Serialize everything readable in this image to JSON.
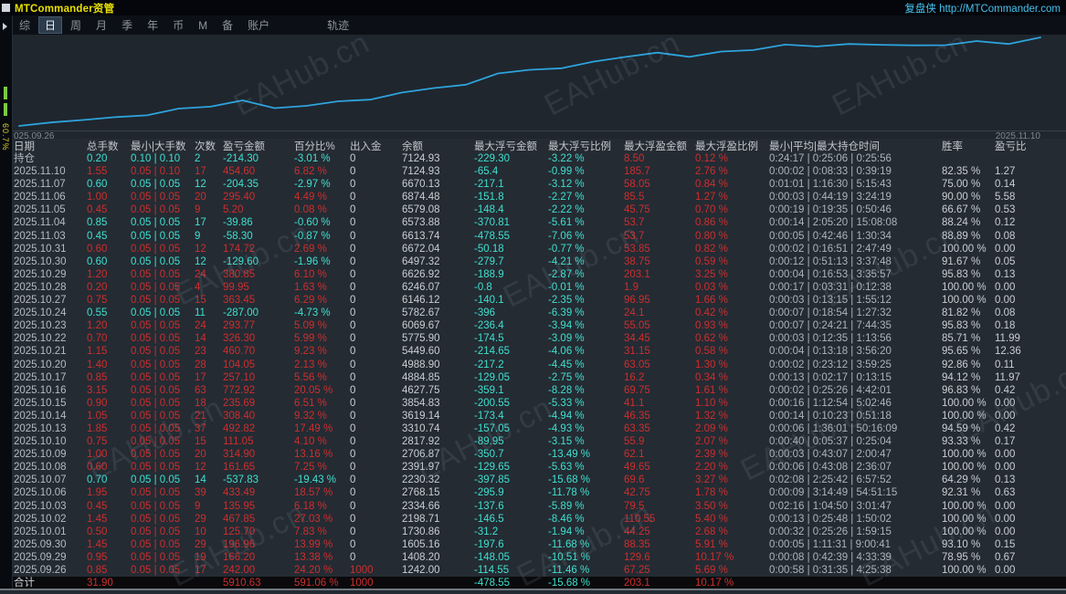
{
  "window": {
    "title": "MTCommander资管",
    "brand": "复盘侠 http://MTCommander.com"
  },
  "menu": {
    "items": [
      "综",
      "日",
      "周",
      "月",
      "季",
      "年",
      "币",
      "M",
      "备",
      "账户",
      "轨迹"
    ],
    "active": "日"
  },
  "left_strip": {
    "label": "60.7%"
  },
  "watermark": "EAHub.cn",
  "chart_data": {
    "type": "line",
    "name": "余额",
    "x_start_label": "025.09.26",
    "x_end_label": "2025.11.10",
    "initial_value": 1000,
    "dates": [
      "2025.09.26",
      "2025.09.29",
      "2025.09.30",
      "2025.10.01",
      "2025.10.02",
      "2025.10.03",
      "2025.10.06",
      "2025.10.07",
      "2025.10.08",
      "2025.10.09",
      "2025.10.10",
      "2025.10.13",
      "2025.10.14",
      "2025.10.15",
      "2025.10.16",
      "2025.10.17",
      "2025.10.20",
      "2025.10.21",
      "2025.10.22",
      "2025.10.23",
      "2025.10.24",
      "2025.10.27",
      "2025.10.28",
      "2025.10.29",
      "2025.10.30",
      "2025.10.31",
      "2025.11.03",
      "2025.11.04",
      "2025.11.05",
      "2025.11.06",
      "2025.11.07",
      "2025.11.10"
    ],
    "values": [
      1000,
      1242.0,
      1408.2,
      1605.16,
      1730.86,
      2198.71,
      2334.66,
      2768.15,
      2230.32,
      2391.97,
      2706.87,
      2817.92,
      3310.74,
      3619.14,
      3854.83,
      4627.75,
      4884.85,
      4988.9,
      5449.6,
      5775.9,
      6069.67,
      5782.67,
      6146.12,
      6246.07,
      6626.92,
      6497.32,
      6672.04,
      6613.74,
      6573.88,
      6579.08,
      6874.48,
      6670.13,
      7124.93
    ],
    "ylim": [
      1000,
      7200
    ],
    "line_color": "#2ea3dc",
    "grid": false,
    "legend": false
  },
  "table": {
    "columns": [
      {
        "key": "date",
        "label": "日期"
      },
      {
        "key": "lots",
        "label": "总手数"
      },
      {
        "key": "minmax",
        "label": "最小|大手数"
      },
      {
        "key": "count",
        "label": "次数"
      },
      {
        "key": "pnl",
        "label": "盈亏金额"
      },
      {
        "key": "pct",
        "label": "百分比%"
      },
      {
        "key": "inout",
        "label": "出入金"
      },
      {
        "key": "balance",
        "label": "余额"
      },
      {
        "key": "maxdd",
        "label": "最大浮亏金额"
      },
      {
        "key": "maxdd_pct",
        "label": "最大浮亏比例"
      },
      {
        "key": "maxfp",
        "label": "最大浮盈金额"
      },
      {
        "key": "maxfp_pct",
        "label": "最大浮盈比例"
      },
      {
        "key": "times",
        "label": "最小|平均|最大持仓时间"
      },
      {
        "key": "winrate",
        "label": "胜率"
      },
      {
        "key": "ratio",
        "label": "盈亏比"
      }
    ],
    "rows": [
      {
        "date": "持仓",
        "lots": "0.20",
        "minmax": "0.10 | 0.10",
        "count": "2",
        "pnl": "-214.30",
        "pct": "-3.01 %",
        "inout": "0",
        "balance": "7124.93",
        "maxdd": "-229.30",
        "maxdd_pct": "-3.22 %",
        "maxfp": "8.50",
        "maxfp_pct": "0.12 %",
        "times": "0:24:17 | 0:25:06 | 0:25:56",
        "winrate": "",
        "ratio": ""
      },
      {
        "date": "2025.11.10",
        "lots": "1.55",
        "minmax": "0.05 | 0.10",
        "count": "17",
        "pnl": "454.60",
        "pct": "6.82 %",
        "inout": "0",
        "balance": "7124.93",
        "maxdd": "-65.4",
        "maxdd_pct": "-0.99 %",
        "maxfp": "185.7",
        "maxfp_pct": "2.76 %",
        "times": "0:00:02 | 0:08:33 | 0:39:19",
        "winrate": "82.35 %",
        "ratio": "1.27"
      },
      {
        "date": "2025.11.07",
        "lots": "0.60",
        "minmax": "0.05 | 0.05",
        "count": "12",
        "pnl": "-204.35",
        "pct": "-2.97 %",
        "inout": "0",
        "balance": "6670.13",
        "maxdd": "-217.1",
        "maxdd_pct": "-3.12 %",
        "maxfp": "58.05",
        "maxfp_pct": "0.84 %",
        "times": "0:01:01 | 1:16:30 | 5:15:43",
        "winrate": "75.00 %",
        "ratio": "0.14"
      },
      {
        "date": "2025.11.06",
        "lots": "1.00",
        "minmax": "0.05 | 0.05",
        "count": "20",
        "pnl": "295.40",
        "pct": "4.49 %",
        "inout": "0",
        "balance": "6874.48",
        "maxdd": "-151.8",
        "maxdd_pct": "-2.27 %",
        "maxfp": "85.5",
        "maxfp_pct": "1.27 %",
        "times": "0:00:03 | 0:44:19 | 3:24:19",
        "winrate": "90.00 %",
        "ratio": "5.58"
      },
      {
        "date": "2025.11.05",
        "lots": "0.45",
        "minmax": "0.05 | 0.05",
        "count": "9",
        "pnl": "5.20",
        "pct": "0.08 %",
        "inout": "0",
        "balance": "6579.08",
        "maxdd": "-148.4",
        "maxdd_pct": "-2.22 %",
        "maxfp": "45.75",
        "maxfp_pct": "0.70 %",
        "times": "0:00:19 | 0:19:35 | 0:50:46",
        "winrate": "66.67 %",
        "ratio": "0.53"
      },
      {
        "date": "2025.11.04",
        "lots": "0.85",
        "minmax": "0.05 | 0.05",
        "count": "17",
        "pnl": "-39.86",
        "pct": "-0.60 %",
        "inout": "0",
        "balance": "6573.88",
        "maxdd": "-370.81",
        "maxdd_pct": "-5.61 %",
        "maxfp": "53.7",
        "maxfp_pct": "0.86 %",
        "times": "0:00:14 | 2:05:20 | 15:08:08",
        "winrate": "88.24 %",
        "ratio": "0.12"
      },
      {
        "date": "2025.11.03",
        "lots": "0.45",
        "minmax": "0.05 | 0.05",
        "count": "9",
        "pnl": "-58.30",
        "pct": "-0.87 %",
        "inout": "0",
        "balance": "6613.74",
        "maxdd": "-478.55",
        "maxdd_pct": "-7.06 %",
        "maxfp": "53.7",
        "maxfp_pct": "0.80 %",
        "times": "0:00:05 | 0:42:46 | 1:30:34",
        "winrate": "88.89 %",
        "ratio": "0.08"
      },
      {
        "date": "2025.10.31",
        "lots": "0.60",
        "minmax": "0.05 | 0.05",
        "count": "12",
        "pnl": "174.72",
        "pct": "2.69 %",
        "inout": "0",
        "balance": "6672.04",
        "maxdd": "-50.18",
        "maxdd_pct": "-0.77 %",
        "maxfp": "53.85",
        "maxfp_pct": "0.82 %",
        "times": "0:00:02 | 0:16:51 | 2:47:49",
        "winrate": "100.00 %",
        "ratio": "0.00"
      },
      {
        "date": "2025.10.30",
        "lots": "0.60",
        "minmax": "0.05 | 0.05",
        "count": "12",
        "pnl": "-129.60",
        "pct": "-1.96 %",
        "inout": "0",
        "balance": "6497.32",
        "maxdd": "-279.7",
        "maxdd_pct": "-4.21 %",
        "maxfp": "38.75",
        "maxfp_pct": "0.59 %",
        "times": "0:00:12 | 0:51:13 | 3:37:48",
        "winrate": "91.67 %",
        "ratio": "0.05"
      },
      {
        "date": "2025.10.29",
        "lots": "1.20",
        "minmax": "0.05 | 0.05",
        "count": "24",
        "pnl": "380.85",
        "pct": "6.10 %",
        "inout": "0",
        "balance": "6626.92",
        "maxdd": "-188.9",
        "maxdd_pct": "-2.87 %",
        "maxfp": "203.1",
        "maxfp_pct": "3.25 %",
        "times": "0:00:04 | 0:16:53 | 3:35:57",
        "winrate": "95.83 %",
        "ratio": "0.13"
      },
      {
        "date": "2025.10.28",
        "lots": "0.20",
        "minmax": "0.05 | 0.05",
        "count": "4",
        "pnl": "99.95",
        "pct": "1.63 %",
        "inout": "0",
        "balance": "6246.07",
        "maxdd": "-0.8",
        "maxdd_pct": "-0.01 %",
        "maxfp": "1.9",
        "maxfp_pct": "0.03 %",
        "times": "0:00:17 | 0:03:31 | 0:12:38",
        "winrate": "100.00 %",
        "ratio": "0.00"
      },
      {
        "date": "2025.10.27",
        "lots": "0.75",
        "minmax": "0.05 | 0.05",
        "count": "15",
        "pnl": "363.45",
        "pct": "6.29 %",
        "inout": "0",
        "balance": "6146.12",
        "maxdd": "-140.1",
        "maxdd_pct": "-2.35 %",
        "maxfp": "96.95",
        "maxfp_pct": "1.66 %",
        "times": "0:00:03 | 0:13:15 | 1:55:12",
        "winrate": "100.00 %",
        "ratio": "0.00"
      },
      {
        "date": "2025.10.24",
        "lots": "0.55",
        "minmax": "0.05 | 0.05",
        "count": "11",
        "pnl": "-287.00",
        "pct": "-4.73 %",
        "inout": "0",
        "balance": "5782.67",
        "maxdd": "-396",
        "maxdd_pct": "-6.39 %",
        "maxfp": "24.1",
        "maxfp_pct": "0.42 %",
        "times": "0:00:07 | 0:18:54 | 1:27:32",
        "winrate": "81.82 %",
        "ratio": "0.08"
      },
      {
        "date": "2025.10.23",
        "lots": "1.20",
        "minmax": "0.05 | 0.05",
        "count": "24",
        "pnl": "293.77",
        "pct": "5.09 %",
        "inout": "0",
        "balance": "6069.67",
        "maxdd": "-236.4",
        "maxdd_pct": "-3.94 %",
        "maxfp": "55.05",
        "maxfp_pct": "0.93 %",
        "times": "0:00:07 | 0:24:21 | 7:44:35",
        "winrate": "95.83 %",
        "ratio": "0.18"
      },
      {
        "date": "2025.10.22",
        "lots": "0.70",
        "minmax": "0.05 | 0.05",
        "count": "14",
        "pnl": "326.30",
        "pct": "5.99 %",
        "inout": "0",
        "balance": "5775.90",
        "maxdd": "-174.5",
        "maxdd_pct": "-3.09 %",
        "maxfp": "34.45",
        "maxfp_pct": "0.62 %",
        "times": "0:00:03 | 0:12:35 | 1:13:56",
        "winrate": "85.71 %",
        "ratio": "11.99"
      },
      {
        "date": "2025.10.21",
        "lots": "1.15",
        "minmax": "0.05 | 0.05",
        "count": "23",
        "pnl": "460.70",
        "pct": "9.23 %",
        "inout": "0",
        "balance": "5449.60",
        "maxdd": "-214.65",
        "maxdd_pct": "-4.06 %",
        "maxfp": "31.15",
        "maxfp_pct": "0.58 %",
        "times": "0:00:04 | 0:13:18 | 3:56:20",
        "winrate": "95.65 %",
        "ratio": "12.36"
      },
      {
        "date": "2025.10.20",
        "lots": "1.40",
        "minmax": "0.05 | 0.05",
        "count": "28",
        "pnl": "104.05",
        "pct": "2.13 %",
        "inout": "0",
        "balance": "4988.90",
        "maxdd": "-217.2",
        "maxdd_pct": "-4.45 %",
        "maxfp": "63.05",
        "maxfp_pct": "1.30 %",
        "times": "0:00:02 | 0:23:12 | 3:59:25",
        "winrate": "92.86 %",
        "ratio": "0.11"
      },
      {
        "date": "2025.10.17",
        "lots": "0.85",
        "minmax": "0.05 | 0.05",
        "count": "17",
        "pnl": "257.10",
        "pct": "5.56 %",
        "inout": "0",
        "balance": "4884.85",
        "maxdd": "-129.05",
        "maxdd_pct": "-2.75 %",
        "maxfp": "16.2",
        "maxfp_pct": "0.34 %",
        "times": "0:00:13 | 0:02:17 | 0:13:15",
        "winrate": "94.12 %",
        "ratio": "11.97"
      },
      {
        "date": "2025.10.16",
        "lots": "3.15",
        "minmax": "0.05 | 0.05",
        "count": "63",
        "pnl": "772.92",
        "pct": "20.05 %",
        "inout": "0",
        "balance": "4627.75",
        "maxdd": "-359.1",
        "maxdd_pct": "-8.28 %",
        "maxfp": "69.75",
        "maxfp_pct": "1.61 %",
        "times": "0:00:02 | 0:25:26 | 4:42:01",
        "winrate": "96.83 %",
        "ratio": "0.42"
      },
      {
        "date": "2025.10.15",
        "lots": "0.90",
        "minmax": "0.05 | 0.05",
        "count": "18",
        "pnl": "235.69",
        "pct": "6.51 %",
        "inout": "0",
        "balance": "3854.83",
        "maxdd": "-200.55",
        "maxdd_pct": "-5.33 %",
        "maxfp": "41.1",
        "maxfp_pct": "1.10 %",
        "times": "0:00:16 | 1:12:54 | 5:02:46",
        "winrate": "100.00 %",
        "ratio": "0.00"
      },
      {
        "date": "2025.10.14",
        "lots": "1.05",
        "minmax": "0.05 | 0.05",
        "count": "21",
        "pnl": "308.40",
        "pct": "9.32 %",
        "inout": "0",
        "balance": "3619.14",
        "maxdd": "-173.4",
        "maxdd_pct": "-4.94 %",
        "maxfp": "46.35",
        "maxfp_pct": "1.32 %",
        "times": "0:00:14 | 0:10:23 | 0:51:18",
        "winrate": "100.00 %",
        "ratio": "0.00"
      },
      {
        "date": "2025.10.13",
        "lots": "1.85",
        "minmax": "0.05 | 0.05",
        "count": "37",
        "pnl": "492.82",
        "pct": "17.49 %",
        "inout": "0",
        "balance": "3310.74",
        "maxdd": "-157.05",
        "maxdd_pct": "-4.93 %",
        "maxfp": "63.35",
        "maxfp_pct": "2.09 %",
        "times": "0:00:06 | 1:36:01 | 50:16:09",
        "winrate": "94.59 %",
        "ratio": "0.42"
      },
      {
        "date": "2025.10.10",
        "lots": "0.75",
        "minmax": "0.05 | 0.05",
        "count": "15",
        "pnl": "111.05",
        "pct": "4.10 %",
        "inout": "0",
        "balance": "2817.92",
        "maxdd": "-89.95",
        "maxdd_pct": "-3.15 %",
        "maxfp": "55.9",
        "maxfp_pct": "2.07 %",
        "times": "0:00:40 | 0:05:37 | 0:25:04",
        "winrate": "93.33 %",
        "ratio": "0.17"
      },
      {
        "date": "2025.10.09",
        "lots": "1.00",
        "minmax": "0.05 | 0.05",
        "count": "20",
        "pnl": "314.90",
        "pct": "13.16 %",
        "inout": "0",
        "balance": "2706.87",
        "maxdd": "-350.7",
        "maxdd_pct": "-13.49 %",
        "maxfp": "62.1",
        "maxfp_pct": "2.39 %",
        "times": "0:00:03 | 0:43:07 | 2:00:47",
        "winrate": "100.00 %",
        "ratio": "0.00"
      },
      {
        "date": "2025.10.08",
        "lots": "0.60",
        "minmax": "0.05 | 0.05",
        "count": "12",
        "pnl": "161.65",
        "pct": "7.25 %",
        "inout": "0",
        "balance": "2391.97",
        "maxdd": "-129.65",
        "maxdd_pct": "-5.63 %",
        "maxfp": "49.65",
        "maxfp_pct": "2.20 %",
        "times": "0:00:06 | 0:43:08 | 2:36:07",
        "winrate": "100.00 %",
        "ratio": "0.00"
      },
      {
        "date": "2025.10.07",
        "lots": "0.70",
        "minmax": "0.05 | 0.05",
        "count": "14",
        "pnl": "-537.83",
        "pct": "-19.43 %",
        "inout": "0",
        "balance": "2230.32",
        "maxdd": "-397.85",
        "maxdd_pct": "-15.68 %",
        "maxfp": "69.6",
        "maxfp_pct": "3.27 %",
        "times": "0:02:08 | 2:25:42 | 6:57:52",
        "winrate": "64.29 %",
        "ratio": "0.13"
      },
      {
        "date": "2025.10.06",
        "lots": "1.95",
        "minmax": "0.05 | 0.05",
        "count": "39",
        "pnl": "433.49",
        "pct": "18.57 %",
        "inout": "0",
        "balance": "2768.15",
        "maxdd": "-295.9",
        "maxdd_pct": "-11.78 %",
        "maxfp": "42.75",
        "maxfp_pct": "1.78 %",
        "times": "0:00:09 | 3:14:49 | 54:51:15",
        "winrate": "92.31 %",
        "ratio": "0.63"
      },
      {
        "date": "2025.10.03",
        "lots": "0.45",
        "minmax": "0.05 | 0.05",
        "count": "9",
        "pnl": "135.95",
        "pct": "6.18 %",
        "inout": "0",
        "balance": "2334.66",
        "maxdd": "-137.6",
        "maxdd_pct": "-5.89 %",
        "maxfp": "79.5",
        "maxfp_pct": "3.50 %",
        "times": "0:02:16 | 1:04:50 | 3:01:47",
        "winrate": "100.00 %",
        "ratio": "0.00"
      },
      {
        "date": "2025.10.02",
        "lots": "1.45",
        "minmax": "0.05 | 0.05",
        "count": "29",
        "pnl": "467.85",
        "pct": "27.03 %",
        "inout": "0",
        "balance": "2198.71",
        "maxdd": "-146.5",
        "maxdd_pct": "-8.46 %",
        "maxfp": "110.55",
        "maxfp_pct": "5.40 %",
        "times": "0:00:13 | 0:25:48 | 1:50:02",
        "winrate": "100.00 %",
        "ratio": "0.00"
      },
      {
        "date": "2025.10.01",
        "lots": "0.50",
        "minmax": "0.05 | 0.05",
        "count": "10",
        "pnl": "125.70",
        "pct": "7.83 %",
        "inout": "0",
        "balance": "1730.86",
        "maxdd": "-31.2",
        "maxdd_pct": "-1.94 %",
        "maxfp": "44.25",
        "maxfp_pct": "2.68 %",
        "times": "0:00:32 | 0:25:26 | 1:59:15",
        "winrate": "100.00 %",
        "ratio": "0.00"
      },
      {
        "date": "2025.09.30",
        "lots": "1.45",
        "minmax": "0.05 | 0.05",
        "count": "29",
        "pnl": "196.96",
        "pct": "13.99 %",
        "inout": "0",
        "balance": "1605.16",
        "maxdd": "-197.6",
        "maxdd_pct": "-11.68 %",
        "maxfp": "88.35",
        "maxfp_pct": "5.91 %",
        "times": "0:00:05 | 1:11:31 | 9:00:41",
        "winrate": "93.10 %",
        "ratio": "0.15"
      },
      {
        "date": "2025.09.29",
        "lots": "0.95",
        "minmax": "0.05 | 0.05",
        "count": "19",
        "pnl": "166.20",
        "pct": "13.38 %",
        "inout": "0",
        "balance": "1408.20",
        "maxdd": "-148.05",
        "maxdd_pct": "-10.51 %",
        "maxfp": "129.6",
        "maxfp_pct": "10.17 %",
        "times": "0:00:08 | 0:42:39 | 4:33:39",
        "winrate": "78.95 %",
        "ratio": "0.67"
      },
      {
        "date": "2025.09.26",
        "lots": "0.85",
        "minmax": "0.05 | 0.05",
        "count": "17",
        "pnl": "242.00",
        "pct": "24.20 %",
        "inout": "1000",
        "balance": "1242.00",
        "maxdd": "-114.55",
        "maxdd_pct": "-11.46 %",
        "maxfp": "67.25",
        "maxfp_pct": "5.69 %",
        "times": "0:00:58 | 0:31:35 | 4:25:38",
        "winrate": "100.00 %",
        "ratio": "0.00"
      },
      {
        "date": "合计",
        "is_total": true,
        "lots": "31.90",
        "minmax": "",
        "count": "",
        "pnl": "5910.63",
        "pct": "591.06 %",
        "inout": "1000",
        "balance": "",
        "maxdd": "-478.55",
        "maxdd_pct": "-15.68 %",
        "maxfp": "203.1",
        "maxfp_pct": "10.17 %",
        "times": "",
        "winrate": "",
        "ratio": ""
      }
    ]
  }
}
